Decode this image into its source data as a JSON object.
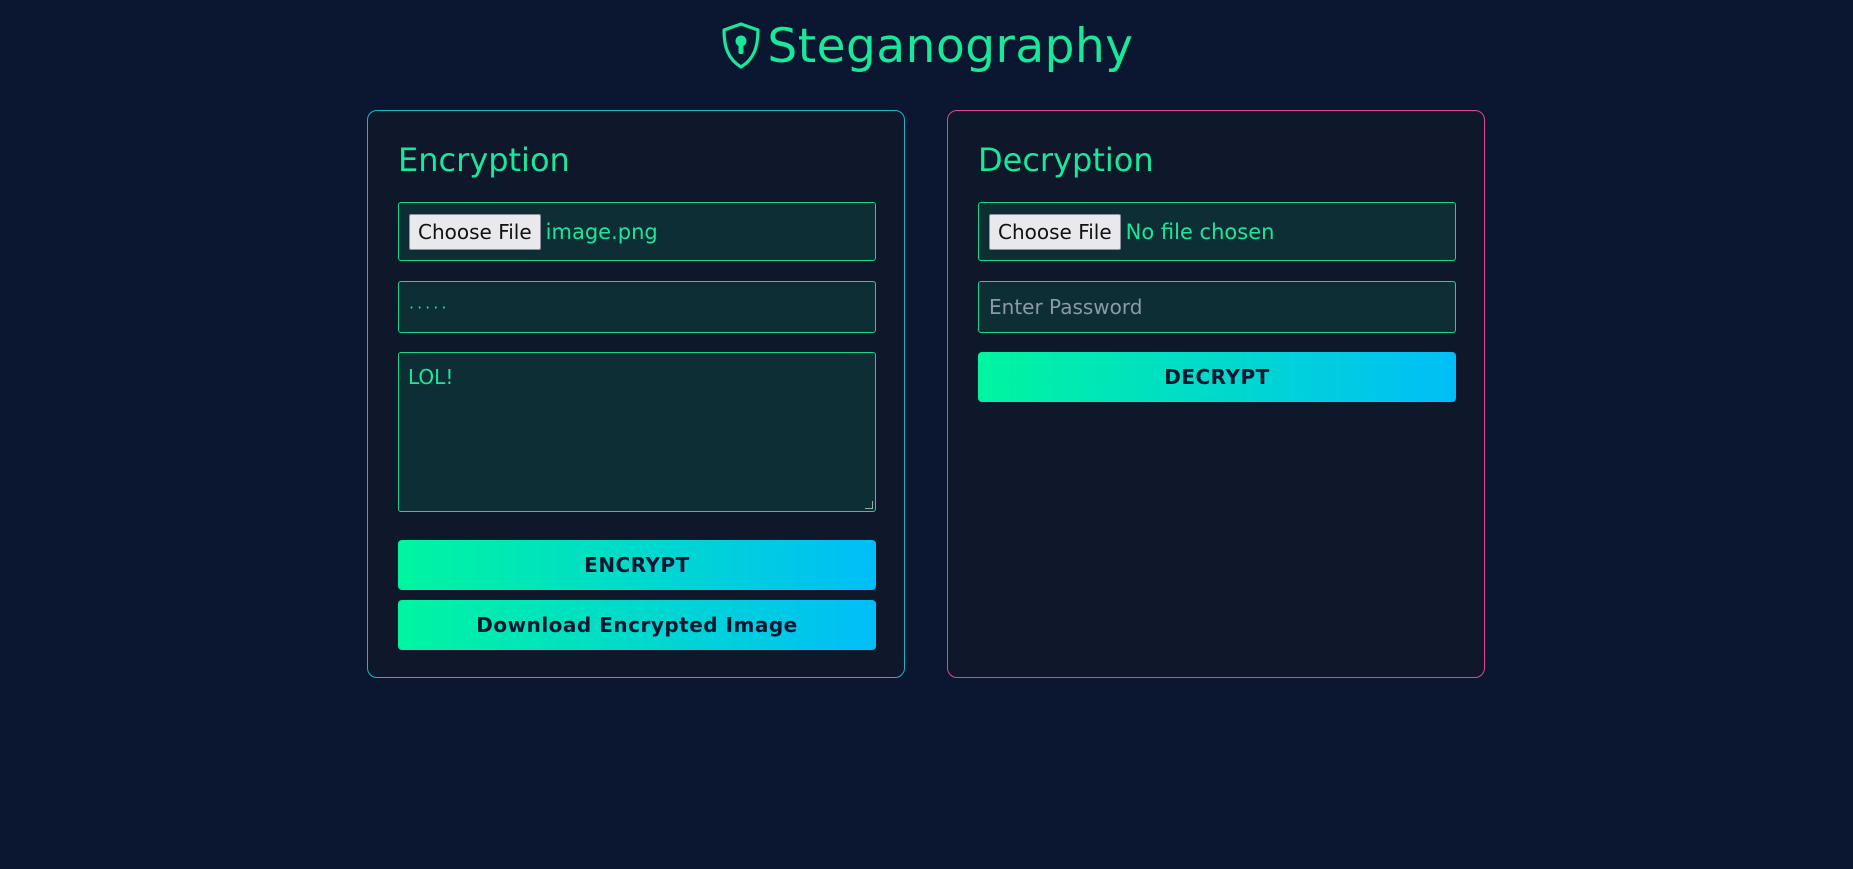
{
  "app": {
    "title": "Steganography"
  },
  "encryption": {
    "heading": "Encryption",
    "choose_file_label": "Choose File",
    "file_name": "image.png",
    "password_value": "·····",
    "message_value": "LOL!",
    "encrypt_label": "ENCRYPT",
    "download_label": "Download Encrypted Image"
  },
  "decryption": {
    "heading": "Decryption",
    "choose_file_label": "Choose File",
    "file_name": "No file chosen",
    "password_placeholder": "Enter Password",
    "decrypt_label": "DECRYPT"
  },
  "colors": {
    "background": "#0b1730",
    "accent": "#18e89a",
    "encryption_border": "#18b6c9",
    "decryption_border": "#e0458f",
    "button_gradient_start": "#00f5a0",
    "button_gradient_end": "#00bef8"
  },
  "icons": {
    "logo": "shield-keyhole-icon"
  }
}
